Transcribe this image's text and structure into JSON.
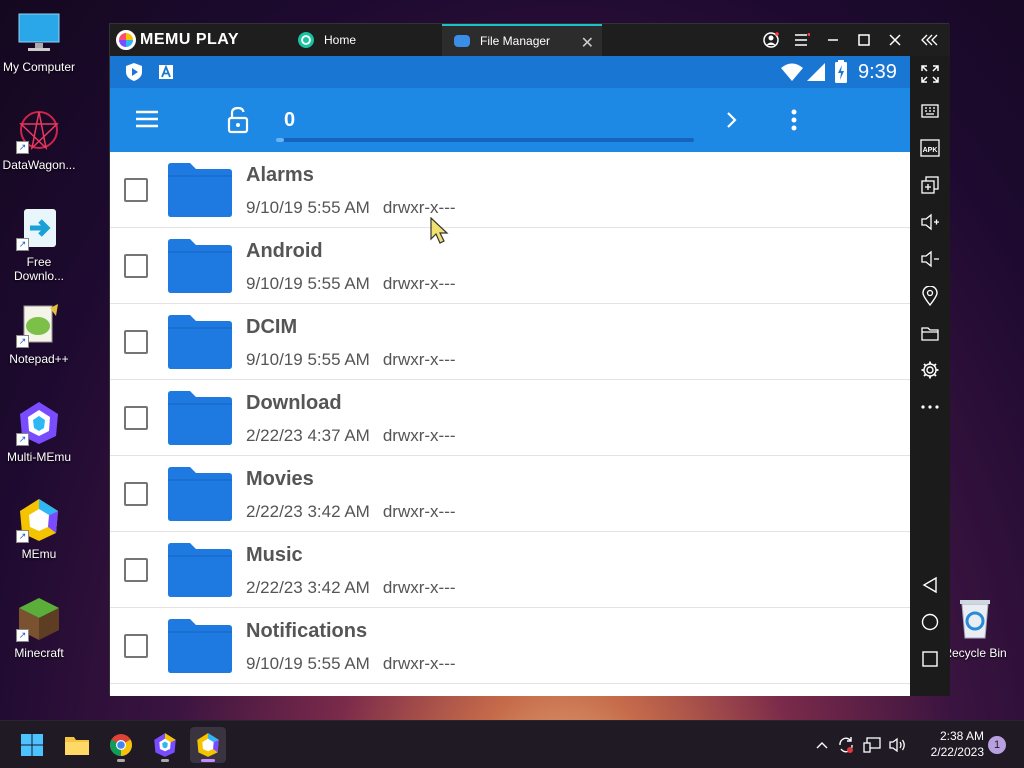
{
  "desktop": {
    "icons": [
      {
        "label": "My Computer"
      },
      {
        "label": "DataWagon..."
      },
      {
        "label": "Free Downlo..."
      },
      {
        "label": "Notepad++"
      },
      {
        "label": "Multi-MEmu"
      },
      {
        "label": "MEmu"
      },
      {
        "label": "Minecraft"
      },
      {
        "label": "Recycle Bin"
      }
    ]
  },
  "emulator": {
    "logo_text": "MEMU PLAY",
    "tabs": [
      {
        "label": "Home",
        "icon": "home-app-icon"
      },
      {
        "label": "File Manager",
        "icon": "folder-icon",
        "active": true
      }
    ],
    "controls": [
      "account-icon",
      "menu-icon",
      "minimize-icon",
      "maximize-icon",
      "close-icon",
      "collapse-icon"
    ],
    "sidebar_tools": [
      "fullscreen-icon",
      "keyboard-icon",
      "apk-icon",
      "multi-window-icon",
      "volume-up-icon",
      "volume-down-icon",
      "location-icon",
      "folder-icon",
      "settings-icon",
      "more-icon",
      "back-icon",
      "home-icon",
      "recents-icon"
    ],
    "apk_label": "APK"
  },
  "android": {
    "status": {
      "time": "9:39"
    },
    "appbar": {
      "path": "0",
      "progress": 0.02
    },
    "files": [
      {
        "name": "Alarms",
        "date": "9/10/19 5:55 AM",
        "perms": "drwxr-x---"
      },
      {
        "name": "Android",
        "date": "9/10/19 5:55 AM",
        "perms": "drwxr-x---"
      },
      {
        "name": "DCIM",
        "date": "9/10/19 5:55 AM",
        "perms": "drwxr-x---"
      },
      {
        "name": "Download",
        "date": "2/22/23 4:37 AM",
        "perms": "drwxr-x---"
      },
      {
        "name": "Movies",
        "date": "2/22/23 3:42 AM",
        "perms": "drwxr-x---"
      },
      {
        "name": "Music",
        "date": "2/22/23 3:42 AM",
        "perms": "drwxr-x---"
      },
      {
        "name": "Notifications",
        "date": "9/10/19 5:55 AM",
        "perms": "drwxr-x---"
      }
    ]
  },
  "taskbar": {
    "time": "2:38 AM",
    "date": "2/22/2023",
    "notification_count": "1"
  },
  "colors": {
    "statusbar": "#1976d2",
    "appbar": "#1e88e5",
    "folder": "#1e7ae0",
    "accent_tab": "#19c2c9"
  }
}
